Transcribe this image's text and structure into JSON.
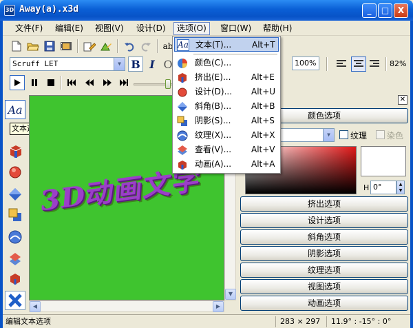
{
  "window": {
    "title": "Away(a).x3d",
    "controls": [
      "_",
      "□",
      "X"
    ]
  },
  "menubar": [
    "文件(F)",
    "编辑(E)",
    "视图(V)",
    "设计(D)",
    "选项(O)",
    "窗口(W)",
    "帮助(H)"
  ],
  "toolbar": {
    "font_name": "Scruff LET",
    "bold": "B",
    "italic": "I",
    "outline": "O",
    "text_tool": "ab",
    "zoom": "100%",
    "percent": "82%"
  },
  "options_menu": [
    {
      "label": "文本(T)...",
      "shortcut": "Alt+T",
      "icon": "text-icon"
    },
    {
      "label": "颜色(C)...",
      "shortcut": "",
      "icon": "color-icon"
    },
    {
      "label": "挤出(E)...",
      "shortcut": "Alt+E",
      "icon": "extrude-icon"
    },
    {
      "label": "设计(D)...",
      "shortcut": "Alt+U",
      "icon": "design-icon"
    },
    {
      "label": "斜角(B)...",
      "shortcut": "Alt+B",
      "icon": "bevel-icon"
    },
    {
      "label": "阴影(S)...",
      "shortcut": "Alt+S",
      "icon": "shadow-icon"
    },
    {
      "label": "纹理(X)...",
      "shortcut": "Alt+X",
      "icon": "texture-icon"
    },
    {
      "label": "查看(V)...",
      "shortcut": "Alt+V",
      "icon": "view-icon"
    },
    {
      "label": "动画(A)...",
      "shortcut": "Alt+A",
      "icon": "animation-icon"
    }
  ],
  "tooltip": "文本选项 (Alt+T)",
  "left_tool": {
    "label": "Aa"
  },
  "canvas": {
    "text": "3D动画文字",
    "bg_color": "#3fc42f",
    "text_color": "#9b3fc8"
  },
  "right_panel": {
    "color_header": "颜色选项",
    "texture_label": "纹理",
    "dye_label": "染色",
    "h_label": "H",
    "h_value": "0°",
    "buttons": [
      "挤出选项",
      "设计选项",
      "斜角选项",
      "阴影选项",
      "纹理选项",
      "视图选项",
      "动画选项"
    ]
  },
  "statusbar": {
    "left": "编辑文本选项",
    "size": "283 × 297",
    "angles": "11.9° : -15° : 0°"
  }
}
